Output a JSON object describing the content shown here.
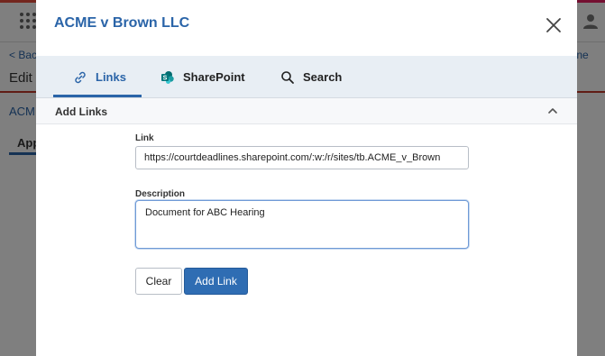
{
  "background": {
    "rainbow_colors": [
      "#e74c3c",
      "#3498db",
      "#9b59b6",
      "#e67e22",
      "#2ecc71",
      "#f1c40f",
      "#1abc9c",
      "#e91e63"
    ],
    "back_link": "< Bac",
    "online_link": "line",
    "edit_label": "Edit",
    "case_link": "ACM",
    "tab_label": "App"
  },
  "modal": {
    "title": "ACME v Brown LLC",
    "close_icon": "close-icon",
    "tabs": [
      {
        "label": "Links",
        "icon": "link-icon",
        "active": true
      },
      {
        "label": "SharePoint",
        "icon": "sharepoint-icon",
        "active": false
      },
      {
        "label": "Search",
        "icon": "search-icon",
        "active": false
      }
    ],
    "section": {
      "title": "Add Links",
      "collapse_icon": "chevron-up-icon"
    },
    "form": {
      "link_label": "Link",
      "link_value": "https://courtdeadlines.sharepoint.com/:w:/r/sites/tb.ACME_v_Brown",
      "description_label": "Description",
      "description_value": "Document for ABC Hearing",
      "clear_label": "Clear",
      "add_label": "Add Link"
    }
  },
  "colors": {
    "accent": "#2a64a8",
    "primary_button": "#2f6db3",
    "tab_bar": "#e8eef4"
  }
}
